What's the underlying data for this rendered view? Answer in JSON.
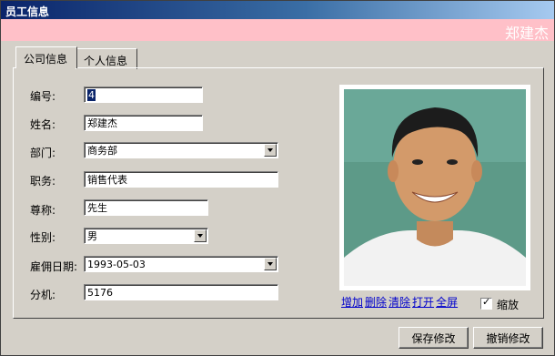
{
  "window": {
    "title": "员工信息"
  },
  "header": {
    "employee_name": "郑建杰"
  },
  "tabs": [
    {
      "label": "公司信息",
      "active": true
    },
    {
      "label": "个人信息",
      "active": false
    }
  ],
  "fields": {
    "id": {
      "label": "编号:",
      "value": "4"
    },
    "name": {
      "label": "姓名:",
      "value": "郑建杰"
    },
    "department": {
      "label": "部门:",
      "value": "商务部"
    },
    "position": {
      "label": "职务:",
      "value": "销售代表"
    },
    "title": {
      "label": "尊称:",
      "value": "先生"
    },
    "gender": {
      "label": "性别:",
      "value": "男"
    },
    "hire_date": {
      "label": "雇佣日期:",
      "value": "1993-05-03"
    },
    "extension": {
      "label": "分机:",
      "value": "5176"
    }
  },
  "photo_actions": [
    "增加",
    "删除",
    "清除",
    "打开",
    "全屏"
  ],
  "zoom": {
    "label": "缩放",
    "checked": true
  },
  "buttons": {
    "save": "保存修改",
    "cancel": "撤销修改"
  }
}
